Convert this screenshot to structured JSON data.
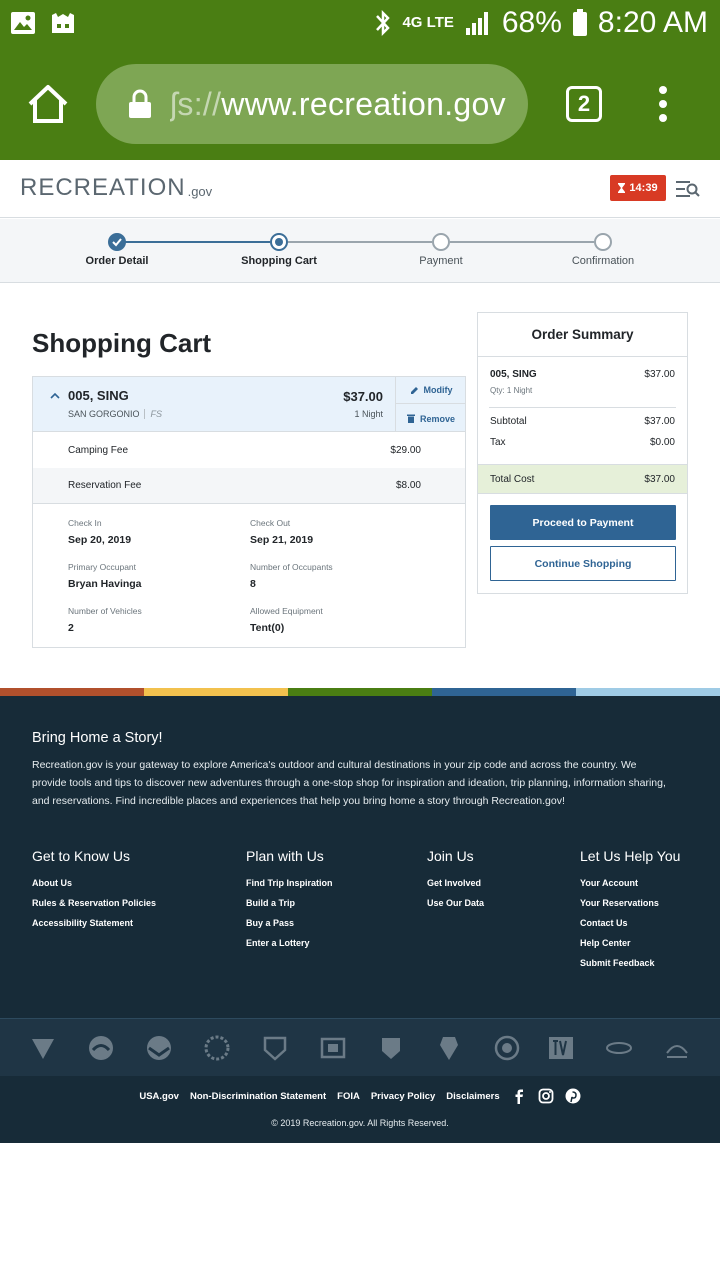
{
  "status_bar": {
    "battery": "68%",
    "time": "8:20 AM",
    "network": "4G LTE"
  },
  "browser": {
    "url_faded": "ʃs://",
    "url_main": "www.recreation.gov",
    "tab_count": "2"
  },
  "header": {
    "logo_word": "RECREATION",
    "logo_suffix": ".gov",
    "timer": "14:39"
  },
  "progress": {
    "steps": [
      {
        "label": "Order Detail",
        "state": "done"
      },
      {
        "label": "Shopping Cart",
        "state": "current"
      },
      {
        "label": "Payment",
        "state": "pending"
      },
      {
        "label": "Confirmation",
        "state": "pending"
      }
    ]
  },
  "cart": {
    "title": "Shopping Cart",
    "item": {
      "site": "005, SING",
      "area": "SAN GORGONIO",
      "agency": "FS",
      "price": "$37.00",
      "nights": "1 Night",
      "modify_label": "Modify",
      "remove_label": "Remove"
    },
    "fees": [
      {
        "name": "Camping Fee",
        "value": "$29.00"
      },
      {
        "name": "Reservation Fee",
        "value": "$8.00"
      }
    ],
    "details": {
      "check_in_label": "Check In",
      "check_in": "Sep 20, 2019",
      "check_out_label": "Check Out",
      "check_out": "Sep 21, 2019",
      "occupant_label": "Primary Occupant",
      "occupant": "Bryan Havinga",
      "occupants_count_label": "Number of Occupants",
      "occupants_count": "8",
      "vehicles_label": "Number of Vehicles",
      "vehicles": "2",
      "equipment_label": "Allowed Equipment",
      "equipment": "Tent(0)"
    }
  },
  "summary": {
    "title": "Order Summary",
    "item_name": "005, SING",
    "item_qty": "Qty: 1 Night",
    "item_price": "$37.00",
    "subtotal_label": "Subtotal",
    "subtotal": "$37.00",
    "tax_label": "Tax",
    "tax": "$0.00",
    "total_label": "Total Cost",
    "total": "$37.00",
    "proceed_label": "Proceed to Payment",
    "continue_label": "Continue Shopping"
  },
  "footer": {
    "title": "Bring Home a Story!",
    "description": "Recreation.gov is your gateway to explore America's outdoor and cultural destinations in your zip code and across the country. We provide tools and tips to discover new adventures through a one-stop shop for inspiration and ideation, trip planning, information sharing, and reservations. Find incredible places and experiences that help you bring home a story through Recreation.gov!",
    "columns": [
      {
        "heading": "Get to Know Us",
        "links": [
          "About Us",
          "Rules & Reservation Policies",
          "Accessibility Statement"
        ]
      },
      {
        "heading": "Plan with Us",
        "links": [
          "Find Trip Inspiration",
          "Build a Trip",
          "Buy a Pass",
          "Enter a Lottery"
        ]
      },
      {
        "heading": "Join Us",
        "links": [
          "Get Involved",
          "Use Our Data"
        ]
      },
      {
        "heading": "Let Us Help You",
        "links": [
          "Your Account",
          "Your Reservations",
          "Contact Us",
          "Help Center",
          "Submit Feedback"
        ]
      }
    ],
    "bottom_links": [
      "USA.gov",
      "Non-Discrimination Statement",
      "FOIA",
      "Privacy Policy",
      "Disclaimers"
    ],
    "copyright": "© 2019 Recreation.gov. All Rights Reserved.",
    "stripe_colors": [
      "#b1502c",
      "#f2c14e",
      "#4a7e13",
      "#2f6494",
      "#9fcbe5"
    ]
  }
}
